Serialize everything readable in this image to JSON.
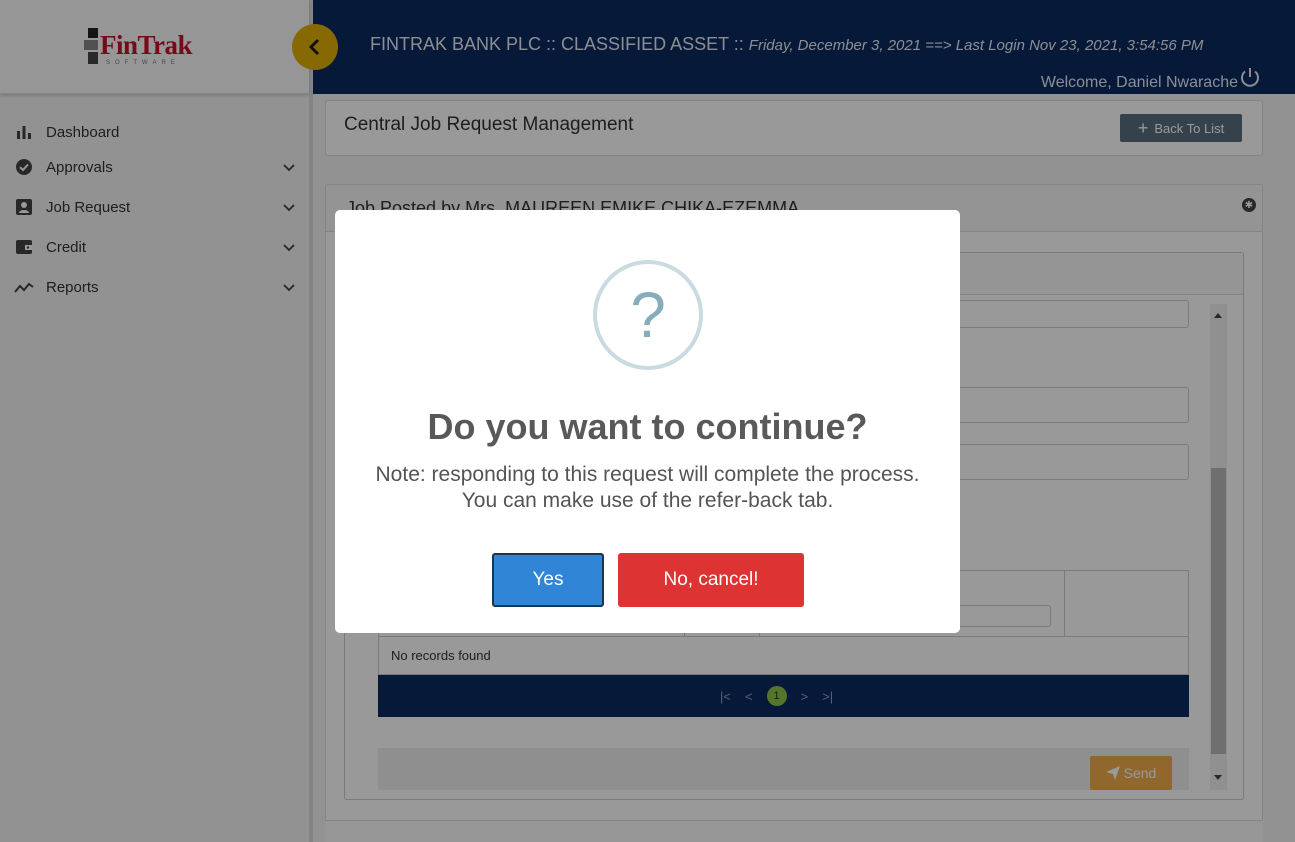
{
  "app": {
    "brand": "FinTrak",
    "brand_tag": "SOFTWARE",
    "header_title": "FINTRAK BANK PLC :: CLASSIFIED ASSET :: ",
    "header_sub": "Friday, December 3, 2021 ==> Last Login Nov 23, 2021, 3:54:56 PM",
    "welcome": "Welcome, Daniel Nwarache"
  },
  "sidebar": {
    "items": [
      {
        "label": "Dashboard",
        "icon": "bar-chart-icon",
        "expandable": false
      },
      {
        "label": "Approvals",
        "icon": "check-circle-icon",
        "expandable": true
      },
      {
        "label": "Job Request",
        "icon": "contact-card-icon",
        "expandable": true
      },
      {
        "label": "Credit",
        "icon": "wallet-icon",
        "expandable": true
      },
      {
        "label": "Reports",
        "icon": "trend-line-icon",
        "expandable": true
      }
    ]
  },
  "main": {
    "page_title": "Central Job Request Management",
    "back_button": "Back To List",
    "job_title": "Job Posted by Mrs. MAUREEN EMIKE CHIKA-EZEMMA",
    "no_records": "No records found",
    "current_page": "1",
    "send_button": "Send"
  },
  "modal": {
    "icon": "?",
    "title": "Do you want to continue?",
    "message": "Note: responding to this request will complete the process. You can make use of the refer-back tab.",
    "confirm_label": "Yes",
    "cancel_label": "No, cancel!"
  },
  "colors": {
    "header_bg": "#0c2a5e",
    "accent_yellow": "#e2b007",
    "confirm": "#3085d6",
    "cancel": "#dd3333",
    "send": "#f0ad4e"
  }
}
